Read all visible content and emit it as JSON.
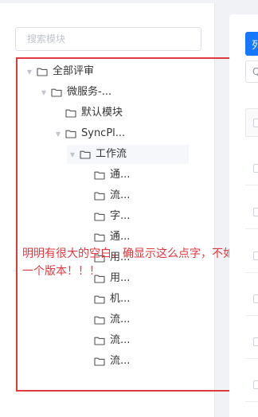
{
  "search": {
    "placeholder": "搜索模块"
  },
  "tree": {
    "nodes": [
      {
        "label": "全部评审",
        "depth": 0,
        "expanded": true,
        "selected": false
      },
      {
        "label": "微服务-...",
        "depth": 1,
        "expanded": true,
        "selected": false
      },
      {
        "label": "默认模块",
        "depth": 2,
        "expanded": false,
        "selected": false
      },
      {
        "label": "SyncPl...",
        "depth": 2,
        "expanded": true,
        "selected": false
      },
      {
        "label": "工作流",
        "depth": 3,
        "expanded": true,
        "selected": true
      },
      {
        "label": "通...",
        "depth": 4,
        "expanded": false,
        "selected": false
      },
      {
        "label": "流...",
        "depth": 4,
        "expanded": false,
        "selected": false
      },
      {
        "label": "字...",
        "depth": 4,
        "expanded": false,
        "selected": false
      },
      {
        "label": "通...",
        "depth": 4,
        "expanded": false,
        "selected": false
      },
      {
        "label": "用...",
        "depth": 4,
        "expanded": false,
        "selected": false
      },
      {
        "label": "用...",
        "depth": 4,
        "expanded": false,
        "selected": false
      },
      {
        "label": "机...",
        "depth": 4,
        "expanded": false,
        "selected": false
      },
      {
        "label": "流...",
        "depth": 4,
        "expanded": false,
        "selected": false
      },
      {
        "label": "流...",
        "depth": 4,
        "expanded": false,
        "selected": false
      },
      {
        "label": "流...",
        "depth": 4,
        "expanded": false,
        "selected": false
      }
    ]
  },
  "annotation": {
    "text": "明明有很大的空白，确显示这么点字，不如上一个版本！！！",
    "color": "#e2383e"
  },
  "right_panel": {
    "primary_button_label": "列",
    "input_prefix": "Q",
    "accent_color": "#1677ff"
  },
  "icons": {
    "caret": "caret-down-icon",
    "folder": "folder-icon"
  }
}
